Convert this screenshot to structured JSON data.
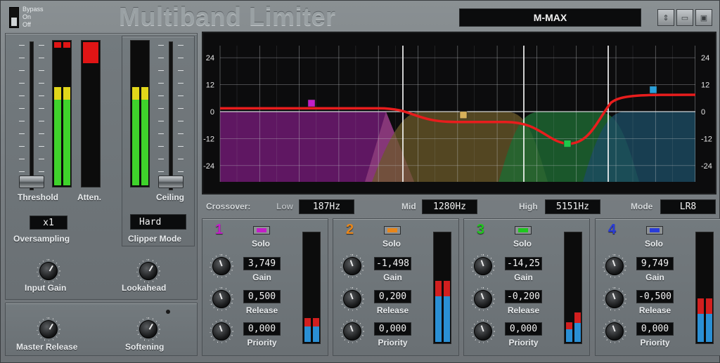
{
  "header": {
    "title": "Multiband Limiter",
    "preset": "M-MAX",
    "bypass_options": [
      "Bypass",
      "On",
      "Off"
    ]
  },
  "left": {
    "threshold_label": "Threshold",
    "atten_label": "Atten.",
    "ceiling_label": "Ceiling",
    "oversampling_value": "x1",
    "oversampling_label": "Oversampling",
    "clipper_value": "Hard",
    "clipper_label": "Clipper Mode",
    "input_gain_label": "Input Gain",
    "lookahead_label": "Lookahead",
    "master_release_label": "Master Release",
    "softening_label": "Softening"
  },
  "graph": {
    "y_ticks": [
      "24",
      "12",
      "0",
      "-12",
      "-24"
    ]
  },
  "crossover": {
    "label": "Crossover:",
    "low_label": "Low",
    "low_value": "187Hz",
    "mid_label": "Mid",
    "mid_value": "1280Hz",
    "high_label": "High",
    "high_value": "5151Hz",
    "mode_label": "Mode",
    "mode_value": "LR8"
  },
  "bands": [
    {
      "number": "1",
      "color": "#c21fc7",
      "solo": "Solo",
      "gain": "3,749",
      "gain_label": "Gain",
      "release": "0,500",
      "release_label": "Release",
      "priority": "0,000",
      "priority_label": "Priority",
      "meter_left": 0.22,
      "meter_right": 0.22
    },
    {
      "number": "2",
      "color": "#e8861a",
      "solo": "Solo",
      "gain": "-1,498",
      "gain_label": "Gain",
      "release": "0,200",
      "release_label": "Release",
      "priority": "0,000",
      "priority_label": "Priority",
      "meter_left": 0.56,
      "meter_right": 0.56
    },
    {
      "number": "3",
      "color": "#1fc71f",
      "solo": "Solo",
      "gain": "-14,25",
      "gain_label": "Gain",
      "release": "-0,200",
      "release_label": "Release",
      "priority": "0,000",
      "priority_label": "Priority",
      "meter_left": 0.18,
      "meter_right": 0.27
    },
    {
      "number": "4",
      "color": "#2a3cd8",
      "solo": "Solo",
      "gain": "9,749",
      "gain_label": "Gain",
      "release": "-0,500",
      "release_label": "Release",
      "priority": "0,000",
      "priority_label": "Priority",
      "meter_left": 0.4,
      "meter_right": 0.4
    }
  ]
}
